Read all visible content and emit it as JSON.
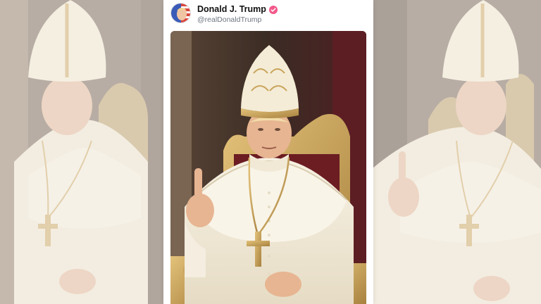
{
  "post": {
    "author": {
      "display_name": "Donald J. Trump",
      "handle": "@realDonaldTrump",
      "verified": true,
      "verified_color": "#f2588a"
    },
    "image": {
      "icon": "papal-portrait-image"
    }
  },
  "background": {
    "icon": "blurred-papal-portrait-image"
  }
}
